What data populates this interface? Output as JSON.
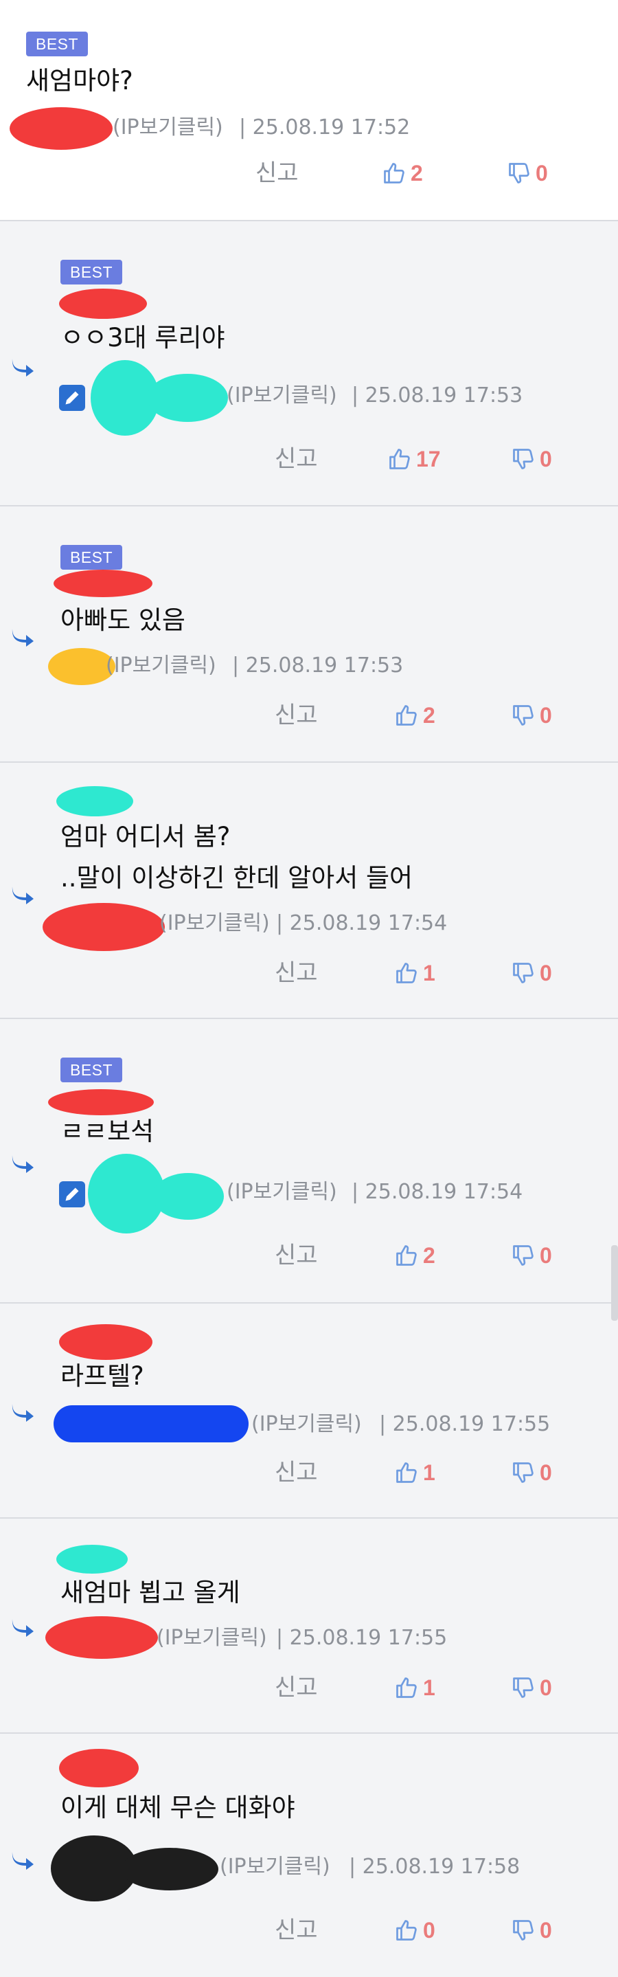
{
  "labels": {
    "best": "BEST",
    "report": "신고",
    "ip_toggle": "(IP보기클릭)"
  },
  "colors": {
    "badge": "#6a7de0",
    "like_icon": "#6f9ce0",
    "count": "#ea7b7b",
    "meta": "#8d9198",
    "reply_arrow": "#2f6fcf"
  },
  "comments": [
    {
      "text": "새엄마야?",
      "datetime": "| 25.08.19 17:52",
      "likes": "2",
      "dislikes": "0"
    },
    {
      "text": "ㅇㅇ3대 루리야",
      "datetime": "| 25.08.19 17:53",
      "likes": "17",
      "dislikes": "0"
    },
    {
      "text": "아빠도 있음",
      "datetime": "| 25.08.19 17:53",
      "likes": "2",
      "dislikes": "0"
    },
    {
      "text": "엄마 어디서 봄?",
      "text2": "..말이 이상하긴 한데 알아서 들어",
      "datetime": "| 25.08.19 17:54",
      "likes": "1",
      "dislikes": "0"
    },
    {
      "text": "ㄹㄹ보석",
      "datetime": "| 25.08.19 17:54",
      "likes": "2",
      "dislikes": "0"
    },
    {
      "text": "라프텔?",
      "datetime": "| 25.08.19 17:55",
      "likes": "1",
      "dislikes": "0"
    },
    {
      "text": "새엄마 뵙고 올게",
      "datetime": "| 25.08.19 17:55",
      "likes": "1",
      "dislikes": "0"
    },
    {
      "text": "이게 대체 무슨 대화야",
      "datetime": "| 25.08.19 17:58",
      "likes": "0",
      "dislikes": "0"
    }
  ]
}
